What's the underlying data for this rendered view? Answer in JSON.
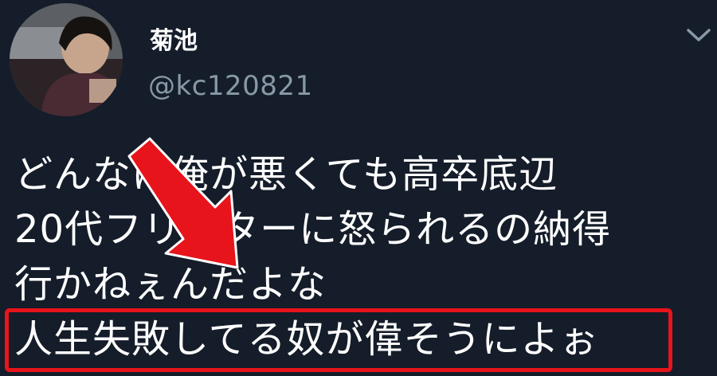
{
  "tweet": {
    "author_name": "菊池",
    "author_handle": "@kc120821",
    "menu_icon": "chevron-down-icon",
    "lines": [
      "どんなに俺が悪くても高卒底辺",
      "20代フリーターに怒られるの納得",
      "行かねぇんだよな",
      "人生失敗してる奴が偉そうによぉ"
    ]
  },
  "colors": {
    "background": "#151d2a",
    "text": "#ffffff",
    "handle": "#8899a6",
    "highlight": "#e8141b",
    "arrow": "#e8141b"
  }
}
